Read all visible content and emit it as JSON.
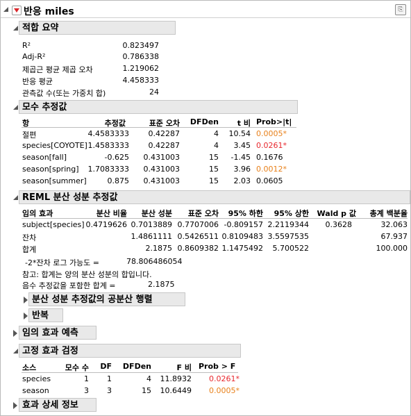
{
  "title": "반응 miles",
  "colors": {
    "red": "#e8272d",
    "orange": "#e8801a",
    "header_bg": "#e9e9e9"
  },
  "fit_summary": {
    "heading": "적합 요약",
    "rows": [
      {
        "label": "R²",
        "value": "0.823497"
      },
      {
        "label": "Adj-R²",
        "value": "0.786338"
      },
      {
        "label": "제곱근 평균 제곱 오차",
        "value": "1.219062"
      },
      {
        "label": "반응 평균",
        "value": "4.458333"
      },
      {
        "label": "관측값 수(또는 가중치 합)",
        "value": "24"
      }
    ]
  },
  "param_est": {
    "heading": "모수 추정값",
    "columns": [
      "항",
      "추정값",
      "표준 오차",
      "DFDen",
      "t 비",
      "Prob>|t|"
    ],
    "rows": [
      {
        "term": "절편",
        "est": "4.4583333",
        "se": "0.42287",
        "df": "4",
        "t": "10.54",
        "p": "0.0005*",
        "pcolor": "orange"
      },
      {
        "term": "species[COYOTE]",
        "est": "1.4583333",
        "se": "0.42287",
        "df": "4",
        "t": "3.45",
        "p": "0.0261*",
        "pcolor": "red"
      },
      {
        "term": "season[fall]",
        "est": "-0.625",
        "se": "0.431003",
        "df": "15",
        "t": "-1.45",
        "p": "0.1676",
        "pcolor": ""
      },
      {
        "term": "season[spring]",
        "est": "1.7083333",
        "se": "0.431003",
        "df": "15",
        "t": "3.96",
        "p": "0.0012*",
        "pcolor": "orange"
      },
      {
        "term": "season[summer]",
        "est": "0.875",
        "se": "0.431003",
        "df": "15",
        "t": "2.03",
        "p": "0.0605",
        "pcolor": ""
      }
    ]
  },
  "reml": {
    "heading": "REML 분산 성분 추정값",
    "columns": [
      "임의 효과",
      "분산 비율",
      "분산 성분",
      "표준 오차",
      "95% 하한",
      "95% 상한",
      "Wald p 값",
      "총계 백분율"
    ],
    "rows": [
      {
        "effect": "subject[species]",
        "ratio": "0.4719626",
        "comp": "0.7013889",
        "se": "0.7707006",
        "lo": "-0.809157",
        "hi": "2.2119344",
        "wald": "0.3628",
        "pct": "32.063"
      },
      {
        "effect": "잔차",
        "ratio": "",
        "comp": "1.4861111",
        "se": "0.5426511",
        "lo": "0.8109483",
        "hi": "3.5597535",
        "wald": "",
        "pct": "67.937"
      },
      {
        "effect": "합계",
        "ratio": "",
        "comp": "2.1875",
        "se": "0.8609382",
        "lo": "1.1475492",
        "hi": "5.700522",
        "wald": "",
        "pct": "100.000"
      }
    ],
    "loglik_label": "-2*잔차 로그 가능도 =",
    "loglik_value": "78.806486054",
    "note": "참고: 합계는 양의 분산 성분의 합입니다.",
    "neg_label": "음수 추정값을 포함한 합계 =",
    "neg_value": "2.1875",
    "sub_cov": "분산 성분 추정값의 공분산 행렬",
    "sub_iter": "반복"
  },
  "random_pred": {
    "heading": "임의 효과 예측"
  },
  "fixed_test": {
    "heading": "고정 효과 검정",
    "columns": [
      "소스",
      "모수 수",
      "DF",
      "DFDen",
      "F 비",
      "Prob > F"
    ],
    "rows": [
      {
        "src": "species",
        "n": "1",
        "df": "1",
        "dfden": "4",
        "f": "11.8932",
        "p": "0.0261*",
        "pcolor": "red"
      },
      {
        "src": "season",
        "n": "3",
        "df": "3",
        "dfden": "15",
        "f": "10.6449",
        "p": "0.0005*",
        "pcolor": "orange"
      }
    ]
  },
  "effect_details": {
    "heading": "효과 상세 정보"
  }
}
